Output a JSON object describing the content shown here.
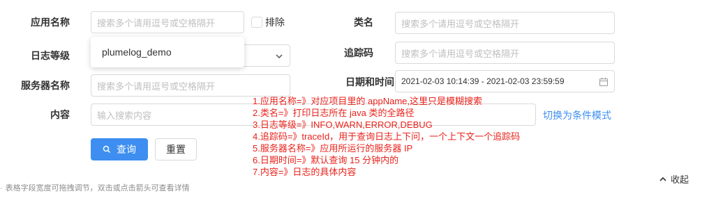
{
  "form": {
    "app_name": {
      "label": "应用名称",
      "placeholder": "搜索多个请用逗号或空格隔开"
    },
    "exclude_label": "排除",
    "class_name": {
      "label": "类名",
      "placeholder": "搜索多个请用逗号或空格隔开"
    },
    "log_level": {
      "label": "日志等级"
    },
    "trace_id": {
      "label": "追踪码",
      "placeholder": "搜索多个请用逗号或空格隔开"
    },
    "server_name": {
      "label": "服务器名称",
      "placeholder": "搜索多个请用逗号或空格隔开"
    },
    "datetime": {
      "label": "日期和时间",
      "value": "2021-02-03 10:14:39 - 2021-02-03 23:59:59"
    },
    "content": {
      "label": "内容",
      "placeholder": "输入搜索内容"
    }
  },
  "dropdown": {
    "items": [
      "plumelog_demo"
    ]
  },
  "buttons": {
    "search": "查询",
    "reset": "重置",
    "toggle_mode": "切换为条件模式",
    "collapse": "收起"
  },
  "annotation_lines": [
    "1.应用名称=》对应项目里的 appName,这里只是模糊搜索",
    "2.类名=》打印日志所在 java 类的全路径",
    "3.日志等级=》INFO,WARN,ERROR,DEBUG",
    "4.追踪码=》traceId，用于查询日志上下问，一个上下文一个追踪码",
    "5.服务器名称=》应用所运行的服务器 IP",
    "6.日期时间=》默认查询 15 分钟内的",
    "7.内容=》日志的具体内容"
  ],
  "table_hint": "表格字段宽度可拖拽调节，双击或点击箭头可查看详情",
  "colors": {
    "primary": "#3d8ef0",
    "annotation": "#e8221b"
  }
}
